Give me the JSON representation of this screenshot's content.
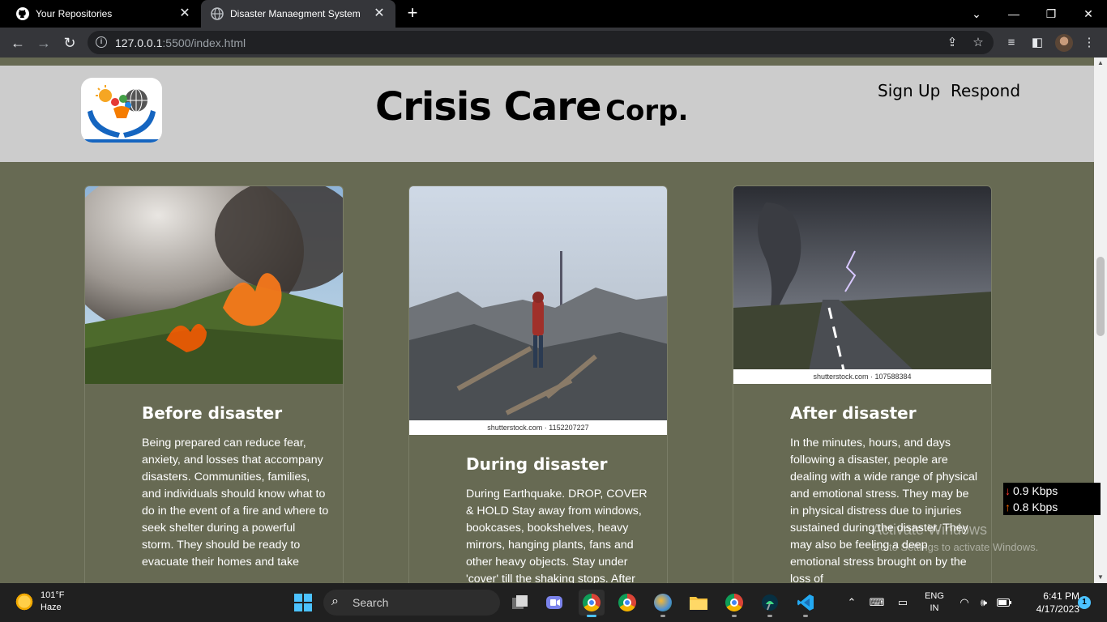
{
  "browser": {
    "tabs": [
      {
        "title": "Your Repositories",
        "icon": "github-icon"
      },
      {
        "title": "Disaster Manaegment System",
        "icon": "globe-icon",
        "active": true
      }
    ],
    "url_host": "127.0.0.1",
    "url_rest": ":5500/index.html"
  },
  "site": {
    "brand_main": "Crisis Care",
    "brand_sub": "Corp.",
    "nav": {
      "signup": "Sign Up",
      "respond": "Respond"
    }
  },
  "cards": [
    {
      "title": "Before disaster",
      "text": "Being prepared can reduce fear, anxiety, and losses that accompany disasters. Communities, families, and individuals should know what to do in the event of a fire and where to seek shelter during a powerful storm. They should be ready to evacuate their homes and take",
      "credit": ""
    },
    {
      "title": "During disaster",
      "text": "During Earthquake. DROP, COVER & HOLD Stay away from windows, bookcases, bookshelves, heavy mirrors, hanging plants, fans and other heavy objects. Stay under 'cover' till the shaking stops. After",
      "credit": "shutterstock.com · 1152207227"
    },
    {
      "title": "After disaster",
      "text": "In the minutes, hours, and days following a disaster, people are dealing with a wide range of physical and emotional stress. They may be in physical distress due to injuries sustained during the disaster. They may also be feeling a deep emotional stress brought on by the loss of",
      "credit": "shutterstock.com · 107588384"
    }
  ],
  "overlay": {
    "download": "0.9 Kbps",
    "upload": "0.8 Kbps",
    "activate_title": "Activate Windows",
    "activate_sub": "Go to Settings to activate Windows."
  },
  "taskbar": {
    "temperature": "101°F",
    "condition": "Haze",
    "search_placeholder": "Search",
    "lang_top": "ENG",
    "lang_bottom": "IN",
    "time": "6:41 PM",
    "date": "4/17/2023",
    "notification_count": "1"
  }
}
